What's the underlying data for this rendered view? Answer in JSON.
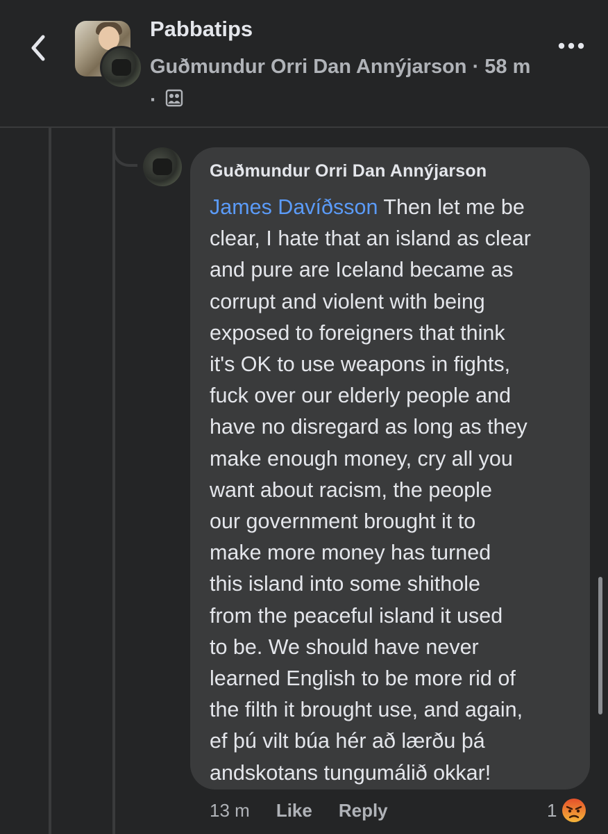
{
  "header": {
    "group_name": "Pabbatips",
    "author": "Guðmundur Orri Dan Annýjarson",
    "separator": " · ",
    "time": "58 m",
    "time_separator": " · ",
    "audience_icon": "group-icon",
    "back_icon": "chevron-left-icon",
    "more_icon": "more-horizontal-icon"
  },
  "comment": {
    "author": "Guðmundur Orri Dan Annýjarson",
    "mention": "James Davíðsson",
    "text": " Then let me be\nclear, I hate that an island as clear\nand pure are Iceland became as\ncorrupt and violent with being\nexposed to foreigners that think\nit's OK to use weapons in fights,\nfuck over our elderly people and\nhave no disregard as long as they\nmake enough money, cry all you\nwant about racism, the people\nour government brought it to\nmake more money has turned\nthis island into some shithole\nfrom the peaceful island it used\nto be. We should have never\nlearned English to be more rid of\nthe filth it brought use, and again,\nef þú vilt búa hér að lærðu þá\nandskotans tungumálið okkar!",
    "time": "13 m",
    "like_label": "Like",
    "reply_label": "Reply",
    "reaction_count": "1",
    "reaction_icon": "angry-reaction-icon"
  },
  "colors": {
    "background": "#242526",
    "bubble": "#3a3b3c",
    "mention": "#5b9bf8",
    "reaction_angry": "#e9710f"
  }
}
